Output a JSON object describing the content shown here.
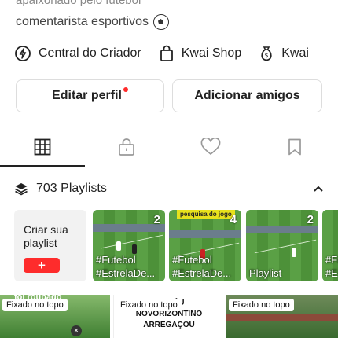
{
  "profile": {
    "top_partial": "apaixonado pelo futebol",
    "bio": "comentarista esportivos"
  },
  "links": [
    {
      "label": "Central do Criador",
      "icon": "lightning-circle-icon"
    },
    {
      "label": "Kwai Shop",
      "icon": "shopping-bag-icon"
    },
    {
      "label": "Kwai",
      "icon": "money-bag-icon"
    }
  ],
  "buttons": {
    "edit_profile": "Editar perfil",
    "add_friends": "Adicionar amigos"
  },
  "tabs": [
    {
      "icon": "grid-icon",
      "active": true
    },
    {
      "icon": "lock-icon",
      "active": false
    },
    {
      "icon": "heart-icon",
      "active": false
    },
    {
      "icon": "bookmark-icon",
      "active": false
    }
  ],
  "playlists": {
    "count_label": "703 Playlists",
    "create_label": "Criar sua playlist",
    "create_button": "+",
    "cards": [
      {
        "count": "2",
        "caption_line1": "#Futebol",
        "caption_line2": "#EstrelaDe..."
      },
      {
        "count": "4",
        "caption_line1": "#Futebol",
        "caption_line2": "#EstrelaDe...",
        "overlay": "pesquisa do jogo"
      },
      {
        "count": "2",
        "caption_line1": "Playlist",
        "caption_line2": ""
      },
      {
        "count": "",
        "caption_line1": "#Fu",
        "caption_line2": "#Es"
      }
    ]
  },
  "videos": [
    {
      "pinned": "Fixado no topo",
      "overlay": "foi roubado"
    },
    {
      "pinned": "Fixado no topo",
      "overlay": "NO CÉU NOVORIZONTINO ARREGAÇOU"
    },
    {
      "pinned": "Fixado no topo",
      "overlay": ""
    }
  ],
  "colors": {
    "accent": "#fe2c2c",
    "text": "#222222",
    "border": "#dddddd"
  }
}
